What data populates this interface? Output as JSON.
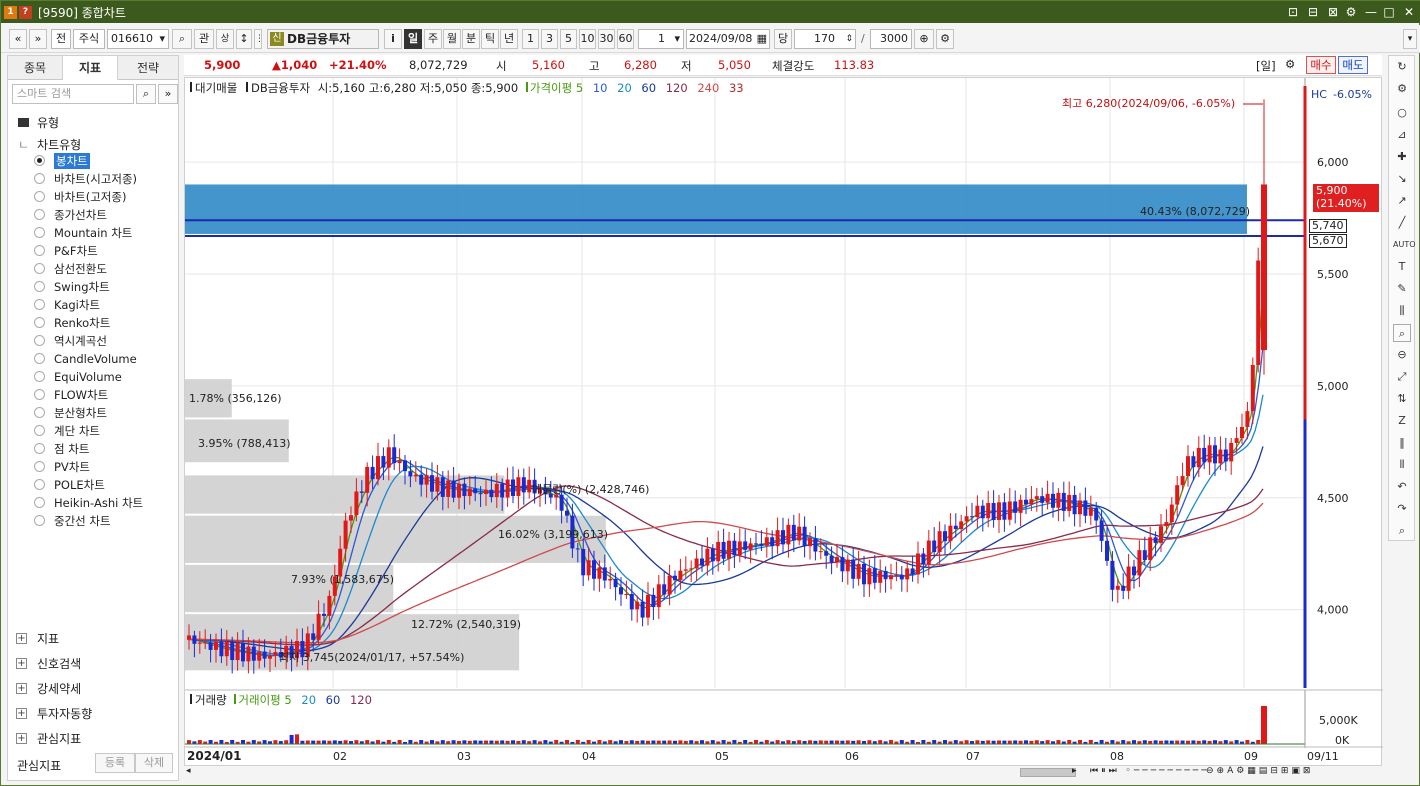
{
  "window": {
    "badges": [
      "1",
      "?"
    ],
    "title": "[9590] 종합차트",
    "controls": [
      "⊡",
      "⊟",
      "⊠",
      "⚙",
      "—",
      "□",
      "✕"
    ]
  },
  "toolbar": {
    "nav": [
      "«",
      "»"
    ],
    "market": "전",
    "type": "주식",
    "code": "016610",
    "search_icon": "search-icon",
    "related": "관",
    "updown": "↕",
    "stock_badge": "신",
    "stock_name": "DB금융투자",
    "info": "i",
    "periods": [
      "일",
      "주",
      "월",
      "분",
      "틱",
      "년"
    ],
    "active_period": "일",
    "intervals": [
      "1",
      "3",
      "5",
      "10",
      "30",
      "60"
    ],
    "interval_value": "1",
    "date": "2024/09/08",
    "count_label": "당",
    "count": "170",
    "total": "3000"
  },
  "left": {
    "tabs": [
      "종목",
      "지표",
      "전략"
    ],
    "active_tab": "지표",
    "search_placeholder": "스마트 검색",
    "tree_root": "유형",
    "tree_node": "차트유형",
    "chart_types": [
      "봉차트",
      "바차트(시고저종)",
      "바차트(고저종)",
      "종가선차트",
      "Mountain 차트",
      "P&F차트",
      "삼선전환도",
      "Swing차트",
      "Kagi차트",
      "Renko차트",
      "역시계곡선",
      "CandleVolume",
      "EquiVolume",
      "FLOW차트",
      "분산형차트",
      "계단 차트",
      "점 차트",
      "PV차트",
      "POLE차트",
      "Heikin-Ashi 차트",
      "중간선 차트"
    ],
    "selected_index": 0,
    "folders": [
      "지표",
      "신호검색",
      "강세약세",
      "투자자동향",
      "관심지표"
    ],
    "bottom_label": "관심지표",
    "bottom_buttons": [
      "등록",
      "삭제"
    ]
  },
  "info": {
    "price": "5,900",
    "change": "▲1,040",
    "change_pct": "+21.40%",
    "volume": "8,072,729",
    "open_label": "시",
    "open": "5,160",
    "high_label": "고",
    "high": "6,280",
    "low_label": "저",
    "low": "5,050",
    "strength_label": "체결강도",
    "strength": "113.83",
    "period_badge": "[일]",
    "buy": "매수",
    "sell": "매도"
  },
  "chart": {
    "legend_title": "대기매물",
    "legend_name": "DB금융투자",
    "ohlc": "시:5,160  고:6,280  저:5,050  종:5,900",
    "ma_label": "가격이평",
    "ma_periods": [
      "5",
      "10",
      "20",
      "60",
      "120",
      "240",
      "33"
    ],
    "ma_colors": {
      "5": "#4a9a10",
      "10": "#2a5ad6",
      "20": "#1a8ad0",
      "60": "#1a3a9a",
      "120": "#8a2a4a",
      "240": "#d04a4a",
      "33": "#b02a2a"
    },
    "hc_label": "HC",
    "hc_value": "-6.05%",
    "max_note": "최고 6,280(2024/09/06, -6.05%)",
    "min_note": "최저 3,745(2024/01/17, +57.54%)",
    "price_tag": "5,900",
    "price_tag_pct": "(21.40%)",
    "h1": "5,740",
    "h2": "5,670",
    "y_ticks": [
      "6,000",
      "5,500",
      "5,000",
      "4,500",
      "4,000"
    ],
    "x_ticks": [
      "2024/01",
      "02",
      "03",
      "04",
      "05",
      "06",
      "07",
      "08",
      "09",
      "09/11"
    ],
    "profile": [
      {
        "price_low": 5670,
        "price_high": 5900,
        "pct": 40.43,
        "label": "40.43% (8,072,729)"
      },
      {
        "price_low": 4850,
        "price_high": 5030,
        "pct": 1.78,
        "label": "1.78% (356,126)"
      },
      {
        "price_low": 4650,
        "price_high": 4850,
        "pct": 3.95,
        "label": "3.95% (788,413)"
      },
      {
        "price_low": 4420,
        "price_high": 4600,
        "pct": 12.16,
        "label": "매물량(%) (2,428,746)"
      },
      {
        "price_low": 4200,
        "price_high": 4420,
        "pct": 16.02,
        "label": "16.02% (3,199,613)"
      },
      {
        "price_low": 3980,
        "price_high": 4200,
        "pct": 7.93,
        "label": "7.93% (1,583,675)"
      },
      {
        "price_low": 3720,
        "price_high": 3980,
        "pct": 12.72,
        "label": "12.72% (2,540,319)"
      }
    ]
  },
  "volume": {
    "label": "거래량",
    "ma_label": "거래이평",
    "ma_periods": [
      "5",
      "20",
      "60",
      "120"
    ],
    "ticks": [
      "5,000K",
      "0K"
    ]
  }
}
